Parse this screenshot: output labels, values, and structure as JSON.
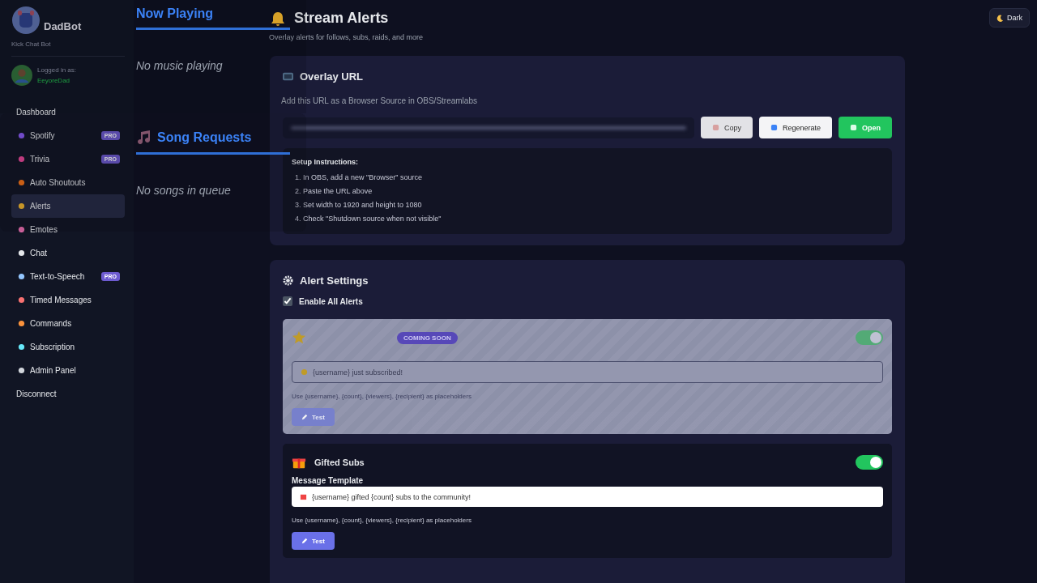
{
  "sidebar": {
    "brand": "DadBot",
    "subtitle": "Kick Chat Bot",
    "user": {
      "label": "Logged in as:",
      "name": "EeyoreDad"
    },
    "nav": [
      {
        "label": "Dashboard",
        "selected": false
      },
      {
        "label": "Spotify",
        "badge": "PRO",
        "selected": false
      },
      {
        "label": "Trivia",
        "badge": "PRO",
        "selected": false
      },
      {
        "label": "Auto Shoutouts",
        "selected": false
      },
      {
        "label": "Alerts",
        "selected": true
      },
      {
        "label": "Emotes",
        "selected": false
      },
      {
        "label": "Chat",
        "selected": false
      },
      {
        "label": "Text-to-Speech",
        "badge": "PRO",
        "selected": false
      },
      {
        "label": "Timed Messages",
        "selected": false
      },
      {
        "label": "Commands",
        "selected": false
      },
      {
        "label": "Subscription",
        "selected": false
      },
      {
        "label": "Admin Panel",
        "selected": false
      }
    ],
    "disconnect": "Disconnect"
  },
  "overlay": {
    "now_playing": {
      "title": "Now Playing",
      "message": "No music playing"
    },
    "song_requests": {
      "title": "Song Requests",
      "message": "No songs in queue"
    }
  },
  "header": {
    "title": "Stream Alerts",
    "subtitle": "Overlay alerts for follows, subs, raids, and more",
    "theme_button": "Dark"
  },
  "overlay_url": {
    "title": "Overlay URL",
    "description": "Add this URL as a Browser Source in OBS/Streamlabs",
    "buttons": [
      {
        "label": "Copy",
        "kind": "light"
      },
      {
        "label": "Regenerate",
        "kind": "white"
      },
      {
        "label": "Open",
        "kind": "green"
      }
    ],
    "instructions": {
      "title": "Setup Instructions:",
      "steps": [
        "1. In OBS, add a new \"Browser\" source",
        "2. Paste the URL above",
        "3. Set width to 1920 and height to 1080",
        "4. Check \"Shutdown source when not visible\""
      ]
    }
  },
  "alert_settings": {
    "title": "Alert Settings",
    "enable_all": {
      "label": "Enable All Alerts",
      "checked": true
    },
    "alerts": [
      {
        "badge": "COMING SOON",
        "on": true,
        "disabled": true,
        "template": "{username} just subscribed!",
        "hint": "Use {username}, {count}, {viewers}, {recipient} as placeholders",
        "test": "Test"
      },
      {
        "name": "Gifted Subs",
        "on": true,
        "disabled": false,
        "label": "Message Template",
        "template": "{username} gifted {count} subs to the community!",
        "hint": "Use {username}, {count}, {viewers}, {recipient} as placeholders",
        "test": "Test"
      }
    ]
  }
}
